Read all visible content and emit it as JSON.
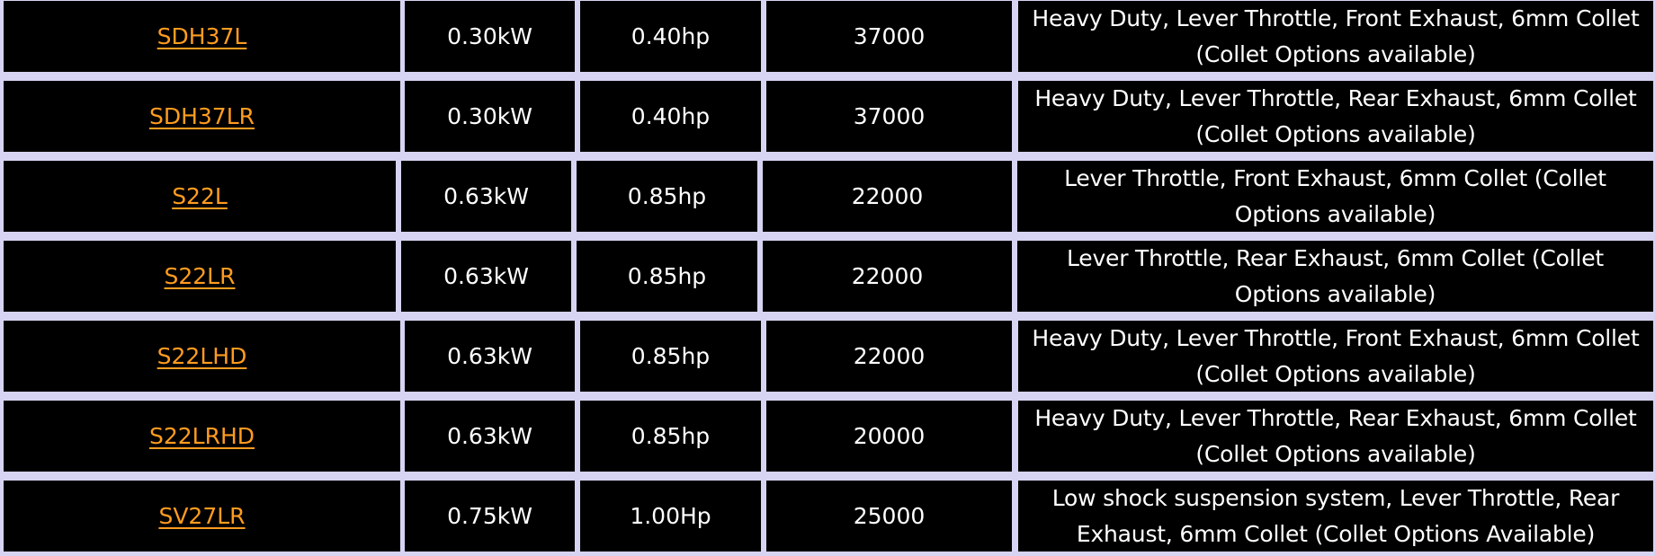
{
  "colors": {
    "cell_background": "#000000",
    "grid_lines": "#d6d4f2",
    "text": "#ffffff",
    "link": "#ff9c1f"
  },
  "rows": [
    {
      "model": "SDH37L",
      "kw": "0.30kW",
      "hp": "0.40hp",
      "rpm": "37000",
      "description": "Heavy Duty, Lever Throttle, Front Exhaust, 6mm Collet (Collet Options available)"
    },
    {
      "model": "SDH37LR",
      "kw": "0.30kW",
      "hp": "0.40hp",
      "rpm": "37000",
      "description": "Heavy Duty, Lever Throttle, Rear Exhaust, 6mm Collet (Collet Options available)"
    },
    {
      "model": "S22L",
      "kw": "0.63kW",
      "hp": "0.85hp",
      "rpm": "22000",
      "description": "Lever Throttle, Front Exhaust, 6mm Collet (Collet Options available)"
    },
    {
      "model": "S22LR",
      "kw": "0.63kW",
      "hp": "0.85hp",
      "rpm": "22000",
      "description": "Lever Throttle, Rear Exhaust, 6mm Collet (Collet Options available)"
    },
    {
      "model": "S22LHD",
      "kw": "0.63kW",
      "hp": "0.85hp",
      "rpm": "22000",
      "description": "Heavy Duty, Lever Throttle, Front Exhaust, 6mm Collet (Collet Options available)"
    },
    {
      "model": "S22LRHD",
      "kw": "0.63kW",
      "hp": "0.85hp",
      "rpm": "20000",
      "description": "Heavy Duty, Lever Throttle, Rear Exhaust, 6mm Collet (Collet Options available)"
    },
    {
      "model": "SV27LR",
      "kw": "0.75kW",
      "hp": "1.00Hp",
      "rpm": "25000",
      "description": "Low shock suspension system, Lever Throttle, Rear Exhaust, 6mm Collet (Collet Options Available)"
    }
  ]
}
